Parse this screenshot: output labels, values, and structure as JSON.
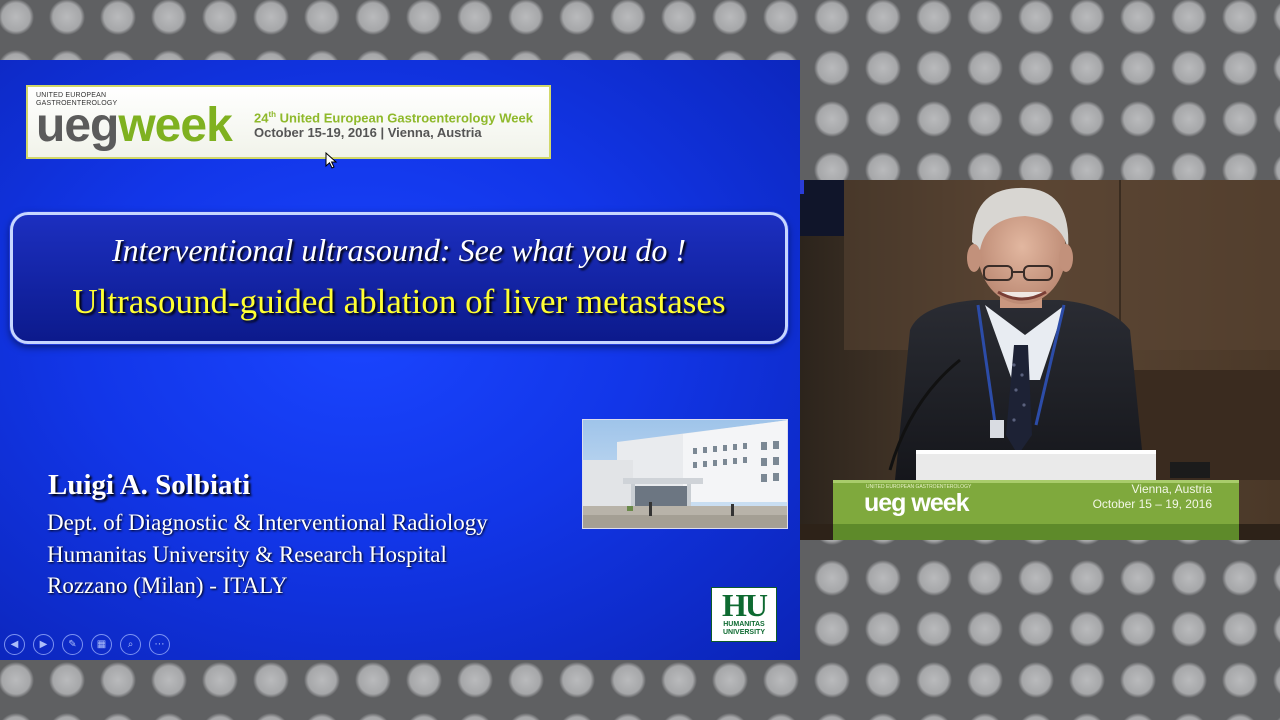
{
  "slide": {
    "banner": {
      "org_small": "UNITED EUROPEAN GASTROENTEROLOGY",
      "logo_ueg": "ueg",
      "logo_week": "week",
      "event_number": "24",
      "event_suffix": "th",
      "event_name": "United European Gastroenterology Week",
      "event_dates_location": "October 15-19, 2016  |  Vienna, Austria"
    },
    "title_line_1": "Interventional ultrasound: See what you do !",
    "title_line_2": "Ultrasound-guided ablation of liver metastases",
    "author": "Luigi  A. Solbiati",
    "affiliation": [
      "Dept. of Diagnostic & Interventional Radiology",
      "Humanitas University & Research Hospital",
      "Rozzano (Milan)  -   ITALY"
    ],
    "hu_logo": {
      "initials": "HU",
      "line_1": "HUMANITAS",
      "line_2": "UNIVERSITY"
    },
    "controls": [
      {
        "name": "previous-slide-button",
        "icon": "◀"
      },
      {
        "name": "next-slide-button",
        "icon": "▶"
      },
      {
        "name": "pen-tool-button",
        "icon": "✎"
      },
      {
        "name": "slides-overview-button",
        "icon": "▦"
      },
      {
        "name": "zoom-button",
        "icon": "⌕"
      },
      {
        "name": "more-options-button",
        "icon": "⋯"
      }
    ]
  },
  "video": {
    "podium_logo_small": "UNITED EUROPEAN GASTROENTEROLOGY",
    "podium_logo_ueg": "ueg",
    "podium_logo_week": " week",
    "podium_location": "Vienna, Austria",
    "podium_dates": "October 15 – 19, 2016"
  },
  "colors": {
    "slide_blue": "#1236e8",
    "title_yellow": "#ffff33",
    "ueg_green": "#7fb120",
    "hu_green": "#0e6a31"
  }
}
